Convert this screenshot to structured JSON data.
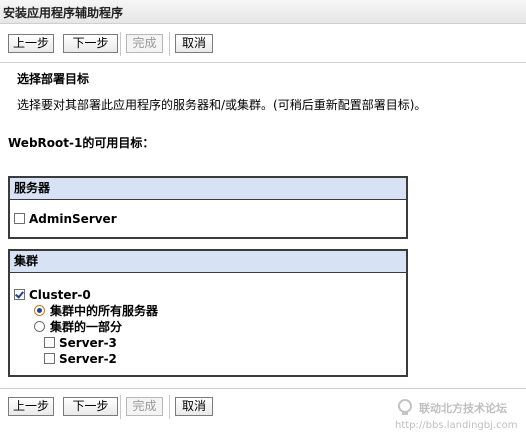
{
  "window": {
    "title": "安装应用程序辅助程序"
  },
  "toolbar": {
    "back_label": "上一步",
    "next_label": "下一步",
    "finish_label": "完成",
    "cancel_label": "取消"
  },
  "section": {
    "title": "选择部署目标",
    "description": "选择要对其部署此应用程序的服务器和/或集群。(可稍后重新配置部署目标)。"
  },
  "targets_heading": "WebRoot-1的可用目标：",
  "servers_panel": {
    "header": "服务器",
    "items": [
      {
        "label": "AdminServer",
        "checked": false
      }
    ]
  },
  "cluster_panel": {
    "header": "集群",
    "cluster": {
      "label": "Cluster-0",
      "checked": true
    },
    "options": [
      {
        "label": "集群中的所有服务器",
        "selected": true
      },
      {
        "label": "集群的一部分",
        "selected": false
      }
    ],
    "members": [
      {
        "label": "Server-3",
        "checked": false
      },
      {
        "label": "Server-2",
        "checked": false
      }
    ]
  },
  "watermark": {
    "line1": "联动北方技术论坛",
    "line2": "http://bbs.landingbj.com",
    "icon": "lightbulb-icon"
  }
}
